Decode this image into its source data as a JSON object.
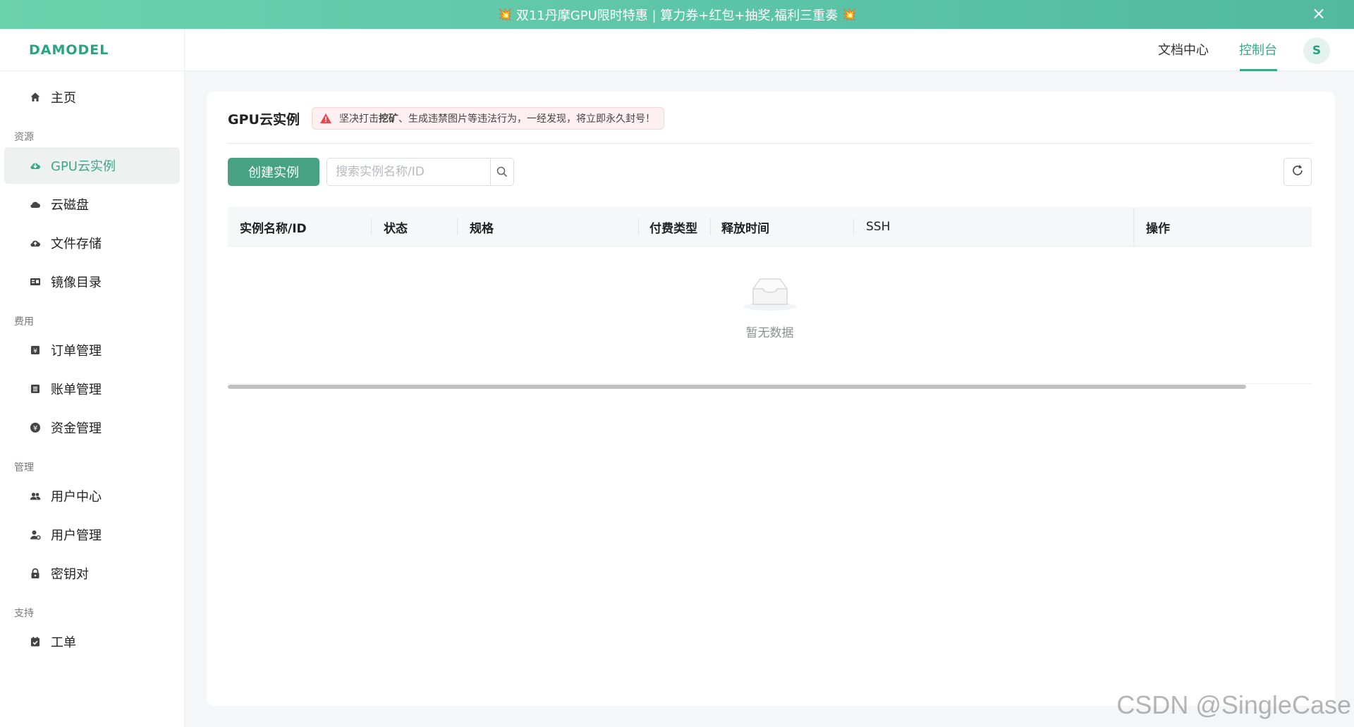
{
  "promo": {
    "text": "双11丹摩GPU限时特惠 | 算力券+红包+抽奖,福利三重奏",
    "close_icon": "close-icon",
    "burst_icon": "burst-icon"
  },
  "brand": {
    "logo": "DAMODEL"
  },
  "header": {
    "docs_label": "文档中心",
    "console_label": "控制台",
    "avatar_initial": "S"
  },
  "sidebar": {
    "home": {
      "label": "主页",
      "icon": "home-icon"
    },
    "group_resources": "资源",
    "gpu": {
      "label": "GPU云实例",
      "icon": "cloud-icon"
    },
    "disk": {
      "label": "云磁盘",
      "icon": "cloud-disk-icon"
    },
    "storage": {
      "label": "文件存储",
      "icon": "cloud-upload-icon"
    },
    "images": {
      "label": "镜像目录",
      "icon": "image-catalog-icon"
    },
    "group_billing": "费用",
    "orders": {
      "label": "订单管理",
      "icon": "order-icon"
    },
    "bills": {
      "label": "账单管理",
      "icon": "bill-icon"
    },
    "funds": {
      "label": "资金管理",
      "icon": "yen-icon"
    },
    "group_manage": "管理",
    "user_center": {
      "label": "用户中心",
      "icon": "users-icon"
    },
    "user_manage": {
      "label": "用户管理",
      "icon": "user-manage-icon"
    },
    "keypair": {
      "label": "密钥对",
      "icon": "lock-icon"
    },
    "group_support": "支持",
    "ticket": {
      "label": "工单",
      "icon": "ticket-icon"
    }
  },
  "main": {
    "title": "GPU云实例",
    "warning_pre": "坚决打击 ",
    "warning_bold": "挖矿",
    "warning_post": "、生成违禁图片等违法行为，一经发现，将立即永久封号！",
    "create_button": "创建实例",
    "search_placeholder": "搜索实例名称/ID",
    "columns": [
      "实例名称/ID",
      "状态",
      "规格",
      "付费类型",
      "释放时间",
      "SSH",
      "操作"
    ],
    "empty_text": "暂无数据"
  },
  "watermark": "CSDN @SingleCase",
  "colors": {
    "accent": "#3ba889",
    "button": "#46a283",
    "banner": "#5ec6a8",
    "warning_bg": "#fef0f0"
  }
}
